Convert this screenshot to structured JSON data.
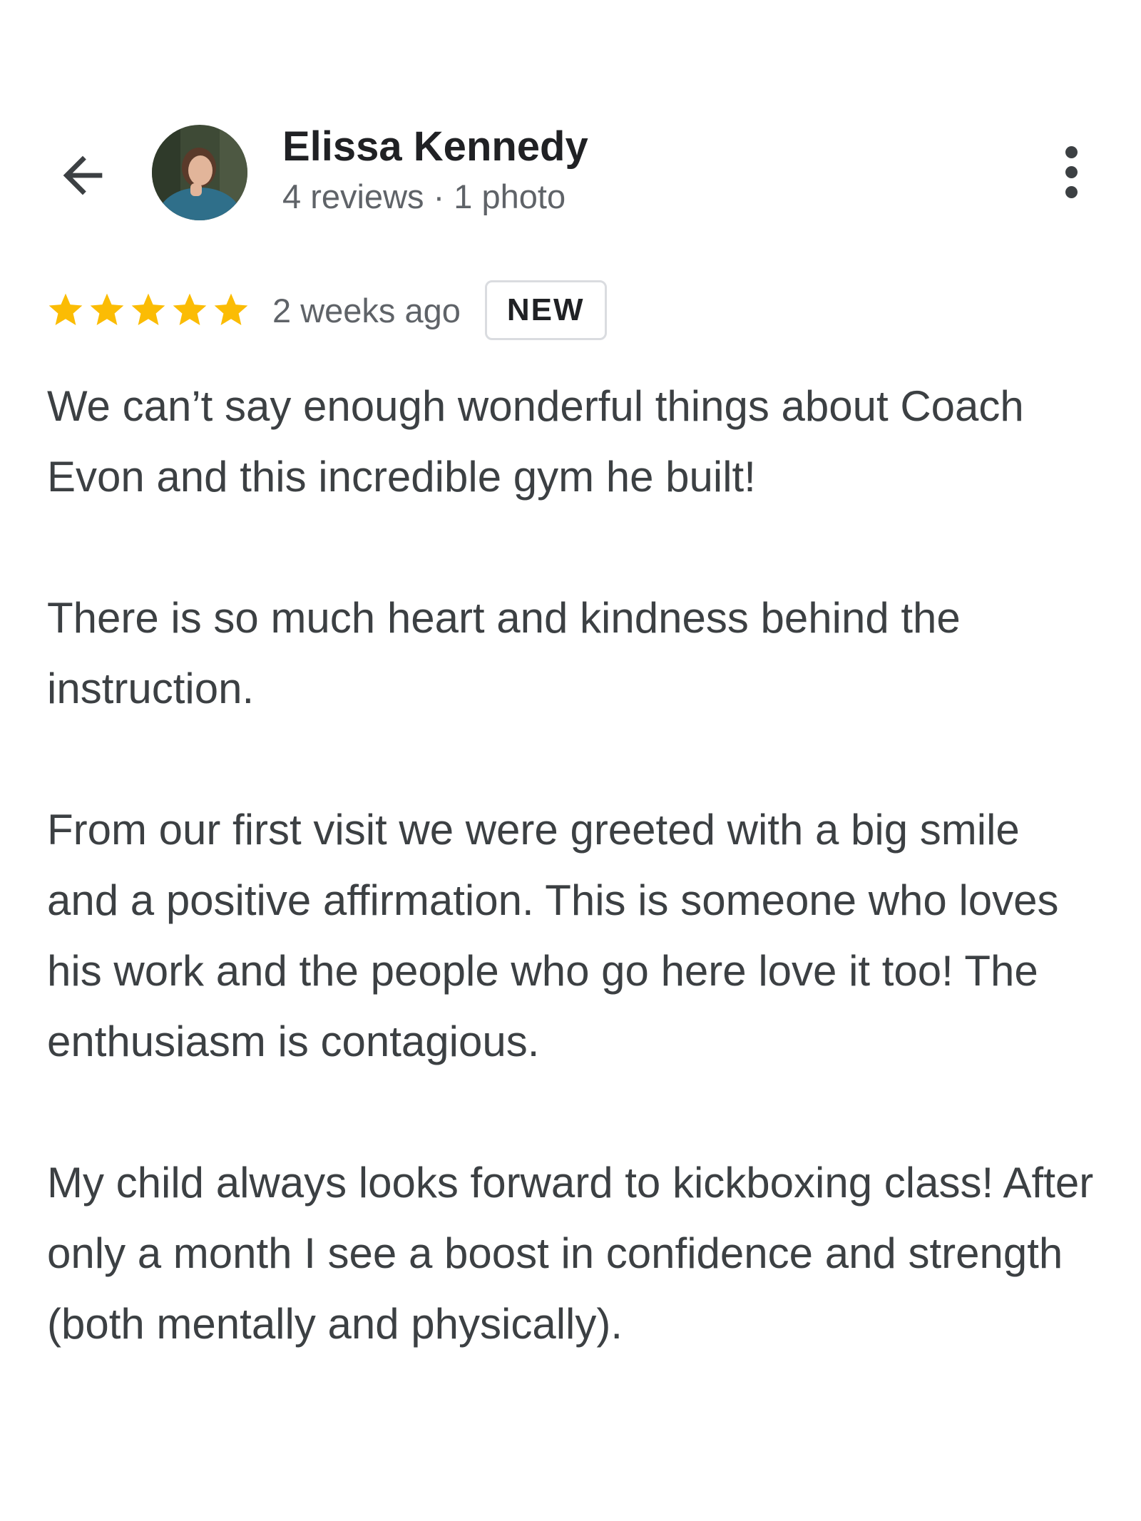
{
  "header": {
    "back_icon": "arrow-back-icon",
    "author_name": "Elissa Kennedy",
    "author_meta": "4 reviews · 1 photo",
    "more_icon": "more-vert-icon"
  },
  "rating": {
    "stars": 5,
    "max_stars": 5,
    "star_color": "#fbbc04",
    "time_ago": "2 weeks ago",
    "badge": "NEW"
  },
  "review": {
    "paragraphs": [
      "We can’t say enough wonderful things about Coach Evon and this incredible gym he built!",
      "There is so much heart and kindness behind the instruction.",
      "From our first visit we were greeted with a big smile and a positive affirmation. This is someone who loves his work and the people who go here love it too! The enthusiasm is contagious.",
      "My child always looks forward to kickboxing class! After only a month I see a boost in confidence and strength (both mentally and physically)."
    ]
  },
  "colors": {
    "text_primary": "#202124",
    "text_body": "#3c4043",
    "text_secondary": "#5f6368",
    "badge_border": "#dadce0"
  }
}
